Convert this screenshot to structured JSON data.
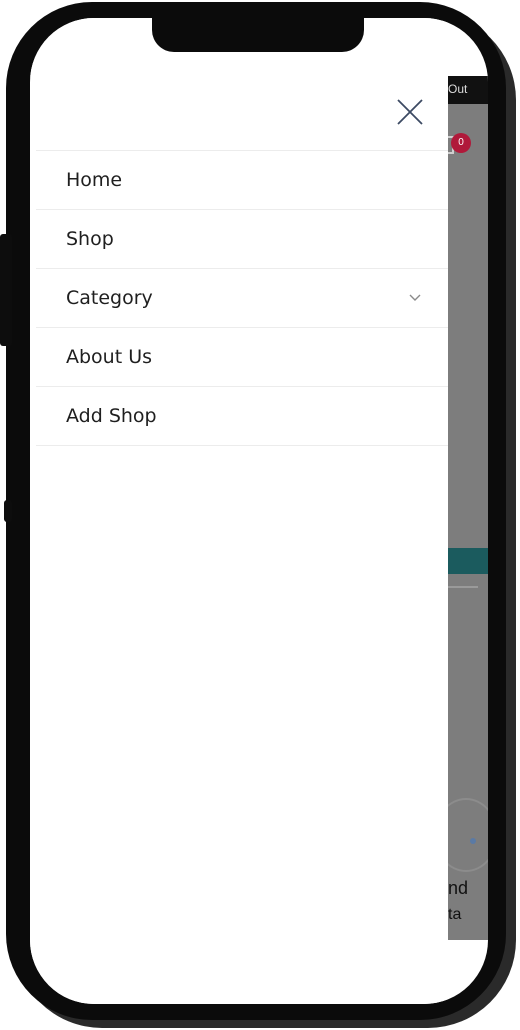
{
  "drawer": {
    "close_icon": "close-icon",
    "items": [
      {
        "label": "Home"
      },
      {
        "label": "Shop"
      },
      {
        "label": "Category",
        "icon": "chevron-down-icon"
      },
      {
        "label": "About Us"
      },
      {
        "label": "Add Shop"
      }
    ]
  },
  "background_page": {
    "topbar_text": "Out",
    "cart_count": "0",
    "peek_text_1": "nd",
    "peek_text_2": "ta"
  },
  "colors": {
    "overlay": "#7d7d7d",
    "badge": "#b0193a",
    "teal": "#1b5b5e",
    "text": "#1f1f1f"
  }
}
